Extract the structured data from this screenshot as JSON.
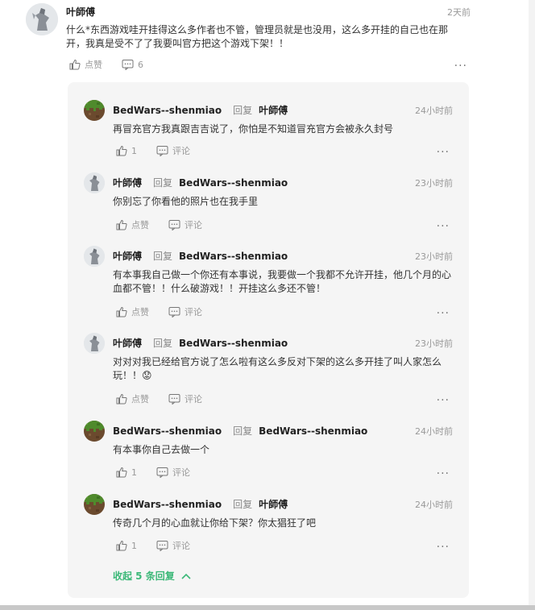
{
  "root": {
    "author": "叶師傅",
    "time": "2天前",
    "text": "什么*东西游戏哇开挂得这么多作者也不管，管理员就是也没用，这么多开挂的自己也在那开，我真是受不了了我要叫官方把这个游戏下架！！",
    "like_label": "点赞",
    "comment_count": "6",
    "more": "···"
  },
  "reply_word": "回复",
  "replies": [
    {
      "author": "BedWars--shenmiao",
      "target": "叶師傅",
      "time": "24小时前",
      "text": "再冒充官方我真跟吉吉说了，你怕是不知道冒充官方会被永久封号",
      "like": "1",
      "comment": "评论",
      "avatar": "grass-block"
    },
    {
      "author": "叶師傅",
      "target": "BedWars--shenmiao",
      "time": "23小时前",
      "text": "你别忘了你看他的照片也在我手里",
      "like": "点赞",
      "comment": "评论",
      "avatar": "statue"
    },
    {
      "author": "叶師傅",
      "target": "BedWars--shenmiao",
      "time": "23小时前",
      "text": "有本事我自己做一个你还有本事说，我要做一个我都不允许开挂，他几个月的心血都不管！！什么破游戏！！开挂这么多还不管！",
      "like": "点赞",
      "comment": "评论",
      "avatar": "statue"
    },
    {
      "author": "叶師傅",
      "target": "BedWars--shenmiao",
      "time": "23小时前",
      "text": "对对对我已经给官方说了怎么啦有这么多反对下架的这么多开挂了叫人家怎么玩！！😟",
      "like": "点赞",
      "comment": "评论",
      "avatar": "statue"
    },
    {
      "author": "BedWars--shenmiao",
      "target": "BedWars--shenmiao",
      "time": "24小时前",
      "text": "有本事你自己去做一个",
      "like": "1",
      "comment": "评论",
      "avatar": "grass-block"
    },
    {
      "author": "BedWars--shenmiao",
      "target": "叶師傅",
      "time": "24小时前",
      "text": "传奇几个月的心血就让你给下架？你太猖狂了吧",
      "like": "1",
      "comment": "评论",
      "avatar": "grass-block"
    }
  ],
  "more_label": "···",
  "collapse_label": "收起 5 条回复",
  "colors": {
    "accent_green": "#3cb878",
    "reply_bg": "#f5f5f5"
  }
}
